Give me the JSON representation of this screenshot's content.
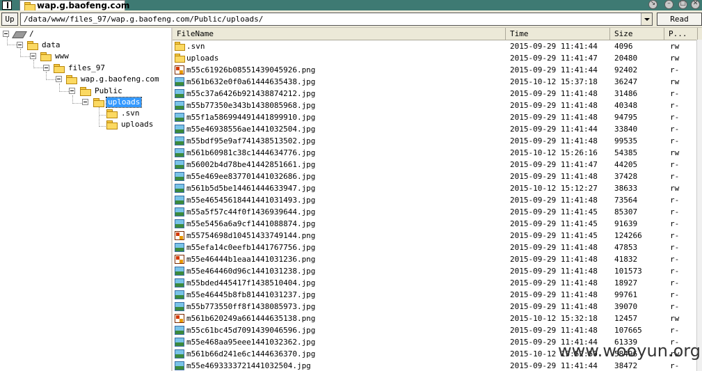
{
  "window": {
    "tab_title": "wap.g.baofeng.com"
  },
  "toolbar": {
    "up_label": "Up",
    "path": "/data/www/files_97/wap.g.baofeng.com/Public/uploads/",
    "read_label": "Read"
  },
  "tree": {
    "nodes": [
      {
        "label": "/"
      },
      {
        "label": "data"
      },
      {
        "label": "www"
      },
      {
        "label": "files_97"
      },
      {
        "label": "wap.g.baofeng.com"
      },
      {
        "label": "Public"
      },
      {
        "label": "uploads",
        "selected": true
      },
      {
        "label": ".svn"
      },
      {
        "label": "uploads"
      }
    ]
  },
  "list": {
    "columns": [
      "FileName",
      "Time",
      "Size",
      "P..."
    ],
    "rows": [
      {
        "icon": "folder-icon",
        "name": ".svn",
        "time": "2015-09-29 11:41:44",
        "size": "4096",
        "perm": "rw"
      },
      {
        "icon": "folder-icon",
        "name": "uploads",
        "time": "2015-09-29 11:41:47",
        "size": "20480",
        "perm": "rw"
      },
      {
        "icon": "png-file-icon",
        "name": "m55c61926b08551439045926.png",
        "time": "2015-09-29 11:41:44",
        "size": "92402",
        "perm": "r-"
      },
      {
        "icon": "jpg-file-icon",
        "name": "m561b632e0f0a61444635438.jpg",
        "time": "2015-10-12 15:37:18",
        "size": "36247",
        "perm": "rw"
      },
      {
        "icon": "jpg-file-icon",
        "name": "m55c37a6426b921438874212.jpg",
        "time": "2015-09-29 11:41:48",
        "size": "31486",
        "perm": "r-"
      },
      {
        "icon": "jpg-file-icon",
        "name": "m55b77350e343b1438085968.jpg",
        "time": "2015-09-29 11:41:48",
        "size": "40348",
        "perm": "r-"
      },
      {
        "icon": "jpg-file-icon",
        "name": "m55f1a586994491441899910.jpg",
        "time": "2015-09-29 11:41:48",
        "size": "94795",
        "perm": "r-"
      },
      {
        "icon": "jpg-file-icon",
        "name": "m55e46938556ae1441032504.jpg",
        "time": "2015-09-29 11:41:44",
        "size": "33840",
        "perm": "r-"
      },
      {
        "icon": "jpg-file-icon",
        "name": "m55bdf95e9af741438513502.jpg",
        "time": "2015-09-29 11:41:48",
        "size": "99535",
        "perm": "r-"
      },
      {
        "icon": "jpg-file-icon",
        "name": "m561b60981c38c1444634776.jpg",
        "time": "2015-10-12 15:26:16",
        "size": "54385",
        "perm": "rw"
      },
      {
        "icon": "jpg-file-icon",
        "name": "m56002b4d78be41442851661.jpg",
        "time": "2015-09-29 11:41:47",
        "size": "44205",
        "perm": "r-"
      },
      {
        "icon": "jpg-file-icon",
        "name": "m55e469ee837701441032686.jpg",
        "time": "2015-09-29 11:41:48",
        "size": "37428",
        "perm": "r-"
      },
      {
        "icon": "jpg-file-icon",
        "name": "m561b5d5be14461444633947.jpg",
        "time": "2015-10-12 15:12:27",
        "size": "38633",
        "perm": "rw"
      },
      {
        "icon": "jpg-file-icon",
        "name": "m55e46545618441441031493.jpg",
        "time": "2015-09-29 11:41:48",
        "size": "73564",
        "perm": "r-"
      },
      {
        "icon": "jpg-file-icon",
        "name": "m55a5f57c44f0f1436939644.jpg",
        "time": "2015-09-29 11:41:45",
        "size": "85307",
        "perm": "r-"
      },
      {
        "icon": "jpg-file-icon",
        "name": "m55e5456a6a9cf1441088874.jpg",
        "time": "2015-09-29 11:41:45",
        "size": "91639",
        "perm": "r-"
      },
      {
        "icon": "png-file-icon",
        "name": "m55754698d10451433749144.png",
        "time": "2015-09-29 11:41:45",
        "size": "124266",
        "perm": "r-"
      },
      {
        "icon": "jpg-file-icon",
        "name": "m55efa14c0eefb1441767756.jpg",
        "time": "2015-09-29 11:41:48",
        "size": "47853",
        "perm": "r-"
      },
      {
        "icon": "png-file-icon",
        "name": "m55e46444b1eaa1441031236.png",
        "time": "2015-09-29 11:41:48",
        "size": "41832",
        "perm": "r-"
      },
      {
        "icon": "jpg-file-icon",
        "name": "m55e464460d96c1441031238.jpg",
        "time": "2015-09-29 11:41:48",
        "size": "101573",
        "perm": "r-"
      },
      {
        "icon": "jpg-file-icon",
        "name": "m55bded445417f1438510404.jpg",
        "time": "2015-09-29 11:41:48",
        "size": "18927",
        "perm": "r-"
      },
      {
        "icon": "jpg-file-icon",
        "name": "m55e46445b8fb81441031237.jpg",
        "time": "2015-09-29 11:41:48",
        "size": "99761",
        "perm": "r-"
      },
      {
        "icon": "jpg-file-icon",
        "name": "m55b773550ff8f1438085973.jpg",
        "time": "2015-09-29 11:41:48",
        "size": "39070",
        "perm": "r-"
      },
      {
        "icon": "png-file-icon",
        "name": "m561b620249a661444635138.png",
        "time": "2015-10-12 15:32:18",
        "size": "12457",
        "perm": "rw"
      },
      {
        "icon": "jpg-file-icon",
        "name": "m55c61bc45d7091439046596.jpg",
        "time": "2015-09-29 11:41:48",
        "size": "107665",
        "perm": "r-"
      },
      {
        "icon": "jpg-file-icon",
        "name": "m55e468aa95eee1441032362.jpg",
        "time": "2015-09-29 11:41:44",
        "size": "61339",
        "perm": "r-"
      },
      {
        "icon": "jpg-file-icon",
        "name": "m561b66d241e6c1444636370.jpg",
        "time": "2015-10-12 15:52:50",
        "size": "58496",
        "perm": "rw"
      },
      {
        "icon": "jpg-file-icon",
        "name": "m55e4693333721441032504.jpg",
        "time": "2015-09-29 11:41:44",
        "size": "38472",
        "perm": "r-"
      }
    ]
  },
  "watermark": "www.wooyun.org"
}
